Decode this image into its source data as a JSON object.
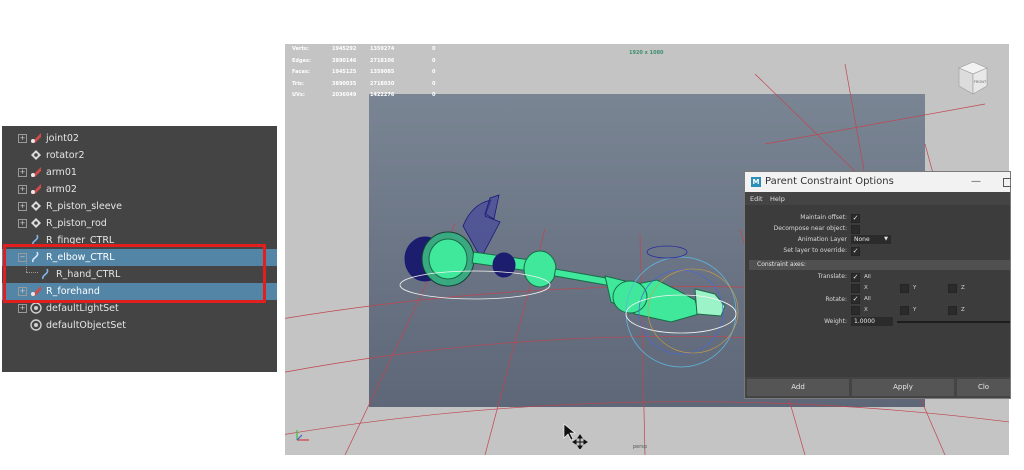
{
  "outliner": {
    "items": [
      {
        "label": "joint02",
        "icon": "joint-icon",
        "expandable": true
      },
      {
        "label": "rotator2",
        "icon": "transform-icon",
        "expandable": false
      },
      {
        "label": "arm01",
        "icon": "joint-icon",
        "expandable": true
      },
      {
        "label": "arm02",
        "icon": "joint-icon",
        "expandable": true
      },
      {
        "label": "R_piston_sleeve",
        "icon": "transform-icon",
        "expandable": true
      },
      {
        "label": "R_piston_rod",
        "icon": "transform-icon",
        "expandable": true
      },
      {
        "label": "R_finger_CTRL",
        "icon": "curve-icon",
        "expandable": false
      },
      {
        "label": "R_elbow_CTRL",
        "icon": "curve-icon",
        "expandable": true,
        "selected": true
      },
      {
        "label": "R_hand_CTRL",
        "icon": "curve-icon",
        "expandable": false
      },
      {
        "label": "R_forehand",
        "icon": "joint-icon",
        "expandable": true,
        "selected": true
      },
      {
        "label": "defaultLightSet",
        "icon": "set-icon",
        "expandable": true
      },
      {
        "label": "defaultObjectSet",
        "icon": "set-icon",
        "expandable": false
      }
    ]
  },
  "viewport": {
    "hud": [
      {
        "label": "Verts:",
        "v1": "1945292",
        "v2": "1359274",
        "v3": "0"
      },
      {
        "label": "Edges:",
        "v1": "3890146",
        "v2": "2718106",
        "v3": "0"
      },
      {
        "label": "Faces:",
        "v1": "1945125",
        "v2": "1359085",
        "v3": "0"
      },
      {
        "label": "Tris:",
        "v1": "3890035",
        "v2": "2718030",
        "v3": "0"
      },
      {
        "label": "UVs:",
        "v1": "2036049",
        "v2": "1422276",
        "v3": "0"
      }
    ],
    "resolution": "1920 x 1080",
    "camera": "persp",
    "viewcube_label": "FRONT"
  },
  "dialog": {
    "title": "Parent Constraint Options",
    "menu": [
      "Edit",
      "Help"
    ],
    "maintain_offset": "Maintain offset:",
    "decompose": "Decompose near object:",
    "animation_layer": "Animation Layer",
    "animation_layer_value": "None",
    "set_layer_override": "Set layer to override:",
    "constraint_axes": "Constraint axes:",
    "translate": "Translate:",
    "rotate": "Rotate:",
    "all": "All",
    "x": "X",
    "y": "Y",
    "z": "Z",
    "weight": "Weight:",
    "weight_value": "1.0000",
    "buttons": {
      "add": "Add",
      "apply": "Apply",
      "close": "Clo"
    },
    "checked": {
      "maintain_offset": true,
      "decompose": false,
      "set_layer_override": true,
      "translate_all": true,
      "rotate_all": true
    },
    "check_glyph": "✓"
  },
  "colors": {
    "outliner_bg": "#444444",
    "selection": "#5285a6",
    "highlight_box": "#e11f1f",
    "wireframe": "#3fe89a",
    "wireframe_dark": "#1a1a78"
  }
}
